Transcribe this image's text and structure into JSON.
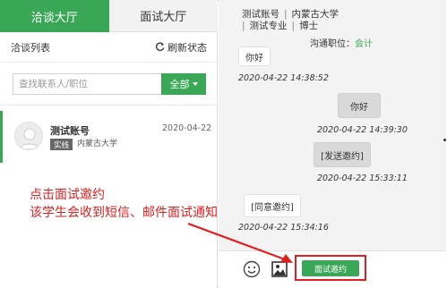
{
  "tabs": {
    "chat": "洽谈大厅",
    "interview": "面试大厅"
  },
  "list": {
    "title": "洽谈列表",
    "refresh": "刷新状态"
  },
  "search": {
    "placeholder": "查找联系人/职位",
    "filter": "全部"
  },
  "contact": {
    "name": "测试账号",
    "date": "2020-04-22",
    "status": "实线",
    "school": "内蒙古大学"
  },
  "header": {
    "account": "测试账号",
    "university": "内蒙古大学",
    "major": "测试专业",
    "degree": "博士",
    "position_label": "沟通职位：",
    "position_value": "会计"
  },
  "messages": [
    {
      "text": "你好",
      "mine": false,
      "time": "2020-04-22 14:38:52"
    },
    {
      "text": "你好",
      "mine": true,
      "time": "2020-04-22 14:39:30"
    },
    {
      "text": "[发送邀约]",
      "mine": true,
      "time": "2020-04-22 15:33:11"
    },
    {
      "text": "[同意邀约]",
      "mine": false,
      "time": "2020-04-22 15:34:16"
    }
  ],
  "toolbar": {
    "invite": "面试邀约",
    "emoji_icon": "emoji-icon",
    "image_icon": "image-icon"
  },
  "annotation": {
    "line1": "点击面试邀约",
    "line2": "该学生会收到短信、邮件面试通知"
  },
  "colors": {
    "accent": "#3aa757",
    "annotation": "#e02020"
  }
}
